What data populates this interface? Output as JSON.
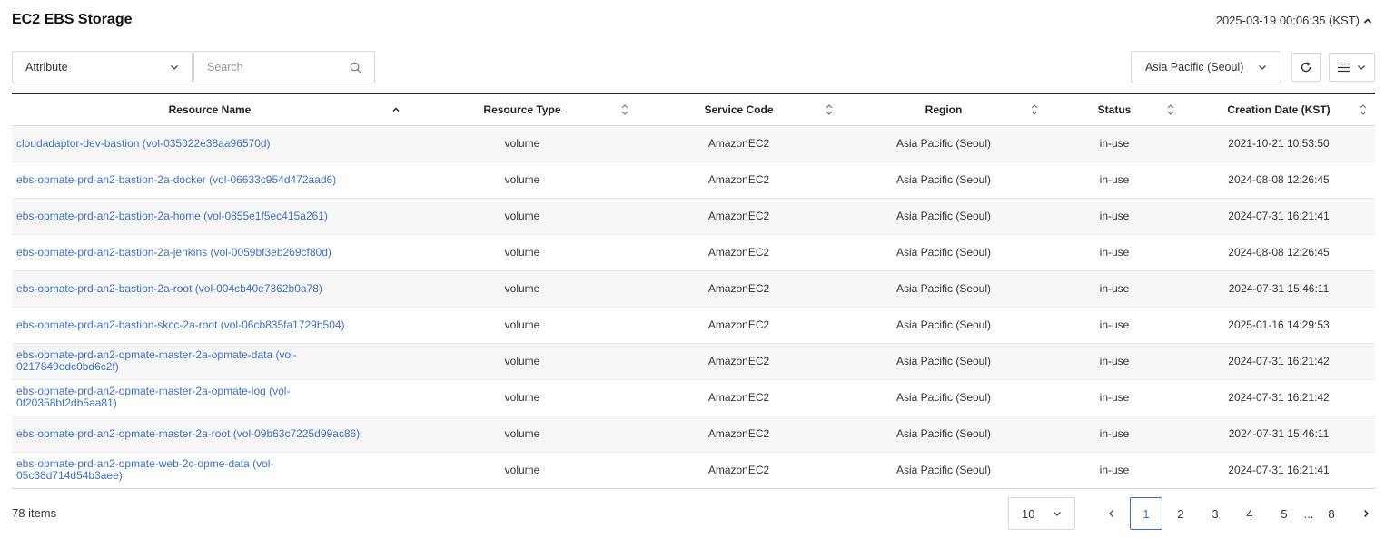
{
  "header": {
    "title": "EC2 EBS Storage",
    "timestamp": "2025-03-19 00:06:35 (KST)"
  },
  "toolbar": {
    "attribute_label": "Attribute",
    "search_placeholder": "Search",
    "region_label": "Asia Pacific (Seoul)"
  },
  "table": {
    "columns": [
      "Resource Name",
      "Resource Type",
      "Service Code",
      "Region",
      "Status",
      "Creation Date (KST)"
    ],
    "rows": [
      [
        "cloudadaptor-dev-bastion (vol-035022e38aa96570d)",
        "volume",
        "AmazonEC2",
        "Asia Pacific (Seoul)",
        "in-use",
        "2021-10-21 10:53:50"
      ],
      [
        "ebs-opmate-prd-an2-bastion-2a-docker (vol-06633c954d472aad6)",
        "volume",
        "AmazonEC2",
        "Asia Pacific (Seoul)",
        "in-use",
        "2024-08-08 12:26:45"
      ],
      [
        "ebs-opmate-prd-an2-bastion-2a-home (vol-0855e1f5ec415a261)",
        "volume",
        "AmazonEC2",
        "Asia Pacific (Seoul)",
        "in-use",
        "2024-07-31 16:21:41"
      ],
      [
        "ebs-opmate-prd-an2-bastion-2a-jenkins (vol-0059bf3eb269cf80d)",
        "volume",
        "AmazonEC2",
        "Asia Pacific (Seoul)",
        "in-use",
        "2024-08-08 12:26:45"
      ],
      [
        "ebs-opmate-prd-an2-bastion-2a-root (vol-004cb40e7362b0a78)",
        "volume",
        "AmazonEC2",
        "Asia Pacific (Seoul)",
        "in-use",
        "2024-07-31 15:46:11"
      ],
      [
        "ebs-opmate-prd-an2-bastion-skcc-2a-root (vol-06cb835fa1729b504)",
        "volume",
        "AmazonEC2",
        "Asia Pacific (Seoul)",
        "in-use",
        "2025-01-16 14:29:53"
      ],
      [
        "ebs-opmate-prd-an2-opmate-master-2a-opmate-data (vol-0217849edc0bd6c2f)",
        "volume",
        "AmazonEC2",
        "Asia Pacific (Seoul)",
        "in-use",
        "2024-07-31 16:21:42"
      ],
      [
        "ebs-opmate-prd-an2-opmate-master-2a-opmate-log (vol-0f20358bf2db5aa81)",
        "volume",
        "AmazonEC2",
        "Asia Pacific (Seoul)",
        "in-use",
        "2024-07-31 16:21:42"
      ],
      [
        "ebs-opmate-prd-an2-opmate-master-2a-root (vol-09b63c7225d99ac86)",
        "volume",
        "AmazonEC2",
        "Asia Pacific (Seoul)",
        "in-use",
        "2024-07-31 15:46:11"
      ],
      [
        "ebs-opmate-prd-an2-opmate-web-2c-opme-data (vol-05c38d714d54b3aee)",
        "volume",
        "AmazonEC2",
        "Asia Pacific (Seoul)",
        "in-use",
        "2024-07-31 16:21:41"
      ]
    ]
  },
  "footer": {
    "item_count": "78 items",
    "page_size": "10",
    "pages": [
      "1",
      "2",
      "3",
      "4",
      "5"
    ],
    "ellipsis": "...",
    "last_page": "8",
    "current_page": "1"
  },
  "colors": {
    "link": "#3a6fd0",
    "accent": "#3a6fd0"
  },
  "icons": {
    "timestamp_toggle": "chevron-up-icon",
    "attribute_dropdown": "chevron-down-icon",
    "search": "search-icon",
    "region_dropdown": "chevron-down-icon",
    "refresh": "refresh-icon",
    "menu": "hamburger-menu-icon",
    "page_prev": "chevron-left-icon",
    "page_next": "chevron-right-icon"
  }
}
